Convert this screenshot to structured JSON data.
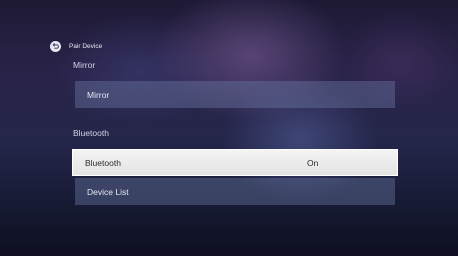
{
  "header": {
    "title": "Pair Device",
    "back_icon": "back-arrow-icon"
  },
  "sections": [
    {
      "label": "Mirror",
      "items": [
        {
          "label": "Mirror"
        }
      ]
    },
    {
      "label": "Bluetooth",
      "items": [
        {
          "label": "Bluetooth",
          "value": "On",
          "focused": true
        },
        {
          "label": "Device List"
        }
      ]
    }
  ],
  "colors": {
    "focus_background": "#efefef",
    "item_background": "#5b6690",
    "text": "#e6e7f3"
  }
}
